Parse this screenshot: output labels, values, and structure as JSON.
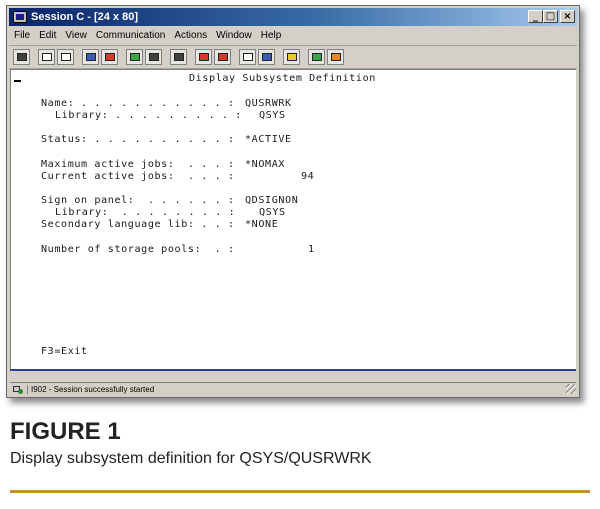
{
  "window": {
    "title": "Session C - [24 x 80]",
    "buttons": {
      "minimize": "_",
      "maximize": "□",
      "close": "×"
    }
  },
  "menu": [
    "File",
    "Edit",
    "View",
    "Communication",
    "Actions",
    "Window",
    "Help"
  ],
  "toolbar": {
    "icons": [
      "print-screen-icon",
      "copy-icon",
      "paste-icon",
      "send-icon",
      "receive-icon",
      "display-icon",
      "keypad-icon",
      "macro-icon",
      "record-icon",
      "play-icon",
      "settings-icon",
      "help-icon",
      "connect-icon",
      "disconnect-icon",
      "globe-icon",
      "pencil-icon"
    ]
  },
  "terminal": {
    "heading": "Display Subsystem Definition",
    "name_label": "Name: . . . . . . . . . . . :",
    "name_value": "QUSRWRK",
    "library_label": "Library: . . . . . . . . . :",
    "library_value": "QSYS",
    "status_label": "Status: . . . . . . . . . . :",
    "status_value": "*ACTIVE",
    "max_jobs_label": "Maximum active jobs:  . . . :",
    "max_jobs_value": "*NOMAX",
    "current_jobs_label": "Current active jobs:  . . . :",
    "current_jobs_value": "94",
    "signon_label": "Sign on panel:  . . . . . . :",
    "signon_value": "QDSIGNON",
    "signon_library_label": "Library:  . . . . . . . . :",
    "signon_library_value": "QSYS",
    "secondary_label": "Secondary language lib: . . :",
    "secondary_value": "*NONE",
    "storage_label": "Number of storage pools:  . :",
    "storage_value": "1",
    "fkey": "F3=Exit"
  },
  "status_bar": {
    "message": "I902 - Session successfully started"
  },
  "figure": {
    "title": "FIGURE 1",
    "caption": "Display subsystem definition for QSYS/QUSRWRK",
    "rule_color": "#c8902a"
  }
}
